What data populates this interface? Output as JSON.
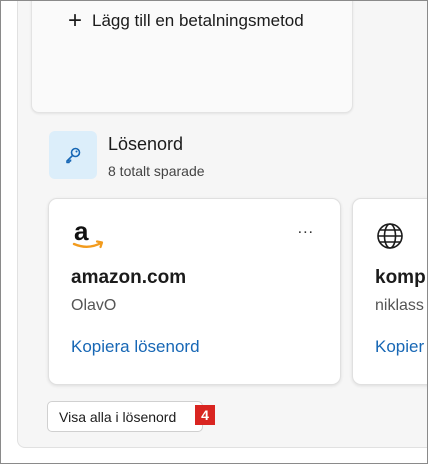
{
  "payment": {
    "add_label": "Lägg till en betalningsmetod"
  },
  "passwords": {
    "title": "Lösenord",
    "subtitle": "8 totalt sparade",
    "cards": [
      {
        "icon": "amazon-logo",
        "site": "amazon.com",
        "username": "OlavO",
        "copy_label": "Kopiera lösenord",
        "menu": "..."
      },
      {
        "icon": "globe-icon",
        "site": "komp",
        "username": "niklass",
        "copy_label": "Kopier"
      }
    ],
    "show_all_label": "Visa alla i lösenord"
  },
  "annotation": {
    "badge_number": "4",
    "badge_color": "#d92521"
  },
  "colors": {
    "link": "#1767b5",
    "icon_tile": "#dceefa"
  }
}
